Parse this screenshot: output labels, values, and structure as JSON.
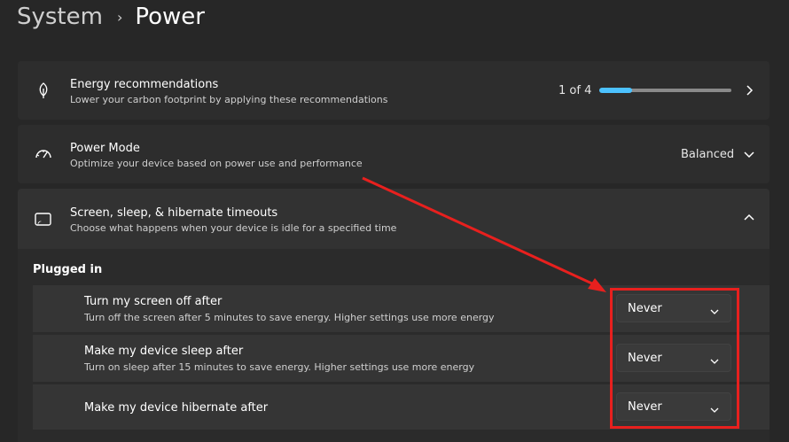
{
  "breadcrumb": {
    "parent": "System",
    "separator": "›",
    "current": "Power"
  },
  "energy": {
    "title": "Energy recommendations",
    "description": "Lower your carbon footprint by applying these recommendations",
    "progress_text": "1 of 4",
    "progress_fraction": 0.25,
    "accent_color": "#4cc2ff",
    "icon": "leaf-icon"
  },
  "power_mode": {
    "title": "Power Mode",
    "description": "Optimize your device based on power use and performance",
    "value": "Balanced",
    "icon": "speedometer-icon"
  },
  "timeouts": {
    "title": "Screen, sleep, & hibernate timeouts",
    "description": "Choose what happens when your device is idle for a specified time",
    "icon": "screen-sleep-icon",
    "section_label": "Plugged in",
    "rows": [
      {
        "title": "Turn my screen off after",
        "description": "Turn off the screen after 5 minutes to save energy. Higher settings use more energy",
        "value": "Never"
      },
      {
        "title": "Make my device sleep after",
        "description": "Turn on sleep after 15 minutes to save energy. Higher settings use more energy",
        "value": "Never"
      },
      {
        "title": "Make my device hibernate after",
        "description": "",
        "value": "Never"
      }
    ]
  },
  "annotation": {
    "color": "#e8201e"
  }
}
